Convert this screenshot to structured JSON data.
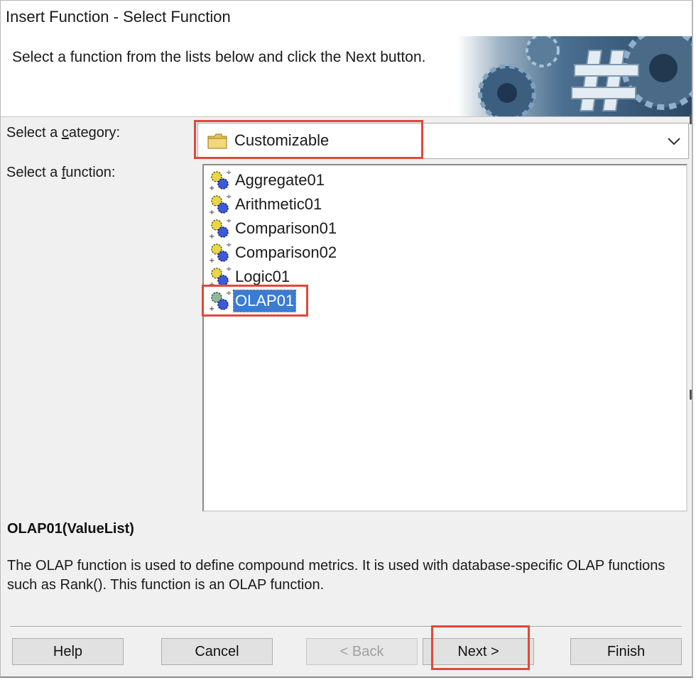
{
  "window": {
    "title": "Insert Function - Select Function"
  },
  "banner": {
    "instruction": "Select a function from the lists below and click the Next button."
  },
  "category": {
    "label_pre": "Select a ",
    "label_key": "c",
    "label_post": "ategory:",
    "selected": "Customizable"
  },
  "function": {
    "label_pre": "Select a ",
    "label_key": "f",
    "label_post": "unction:",
    "items": [
      "Aggregate01",
      "Arithmetic01",
      "Comparison01",
      "Comparison02",
      "Logic01",
      "OLAP01"
    ],
    "selected_index": 5
  },
  "details": {
    "signature": "OLAP01(ValueList)",
    "description": "The OLAP function is used to define compound metrics. It is used with database-specific OLAP functions such as Rank(). This function is an OLAP function."
  },
  "buttons": {
    "help": "Help",
    "cancel": "Cancel",
    "back": "< Back",
    "next": "Next >",
    "finish": "Finish"
  },
  "colors": {
    "highlight": "#e0483a",
    "selection": "#3a7bd5"
  }
}
